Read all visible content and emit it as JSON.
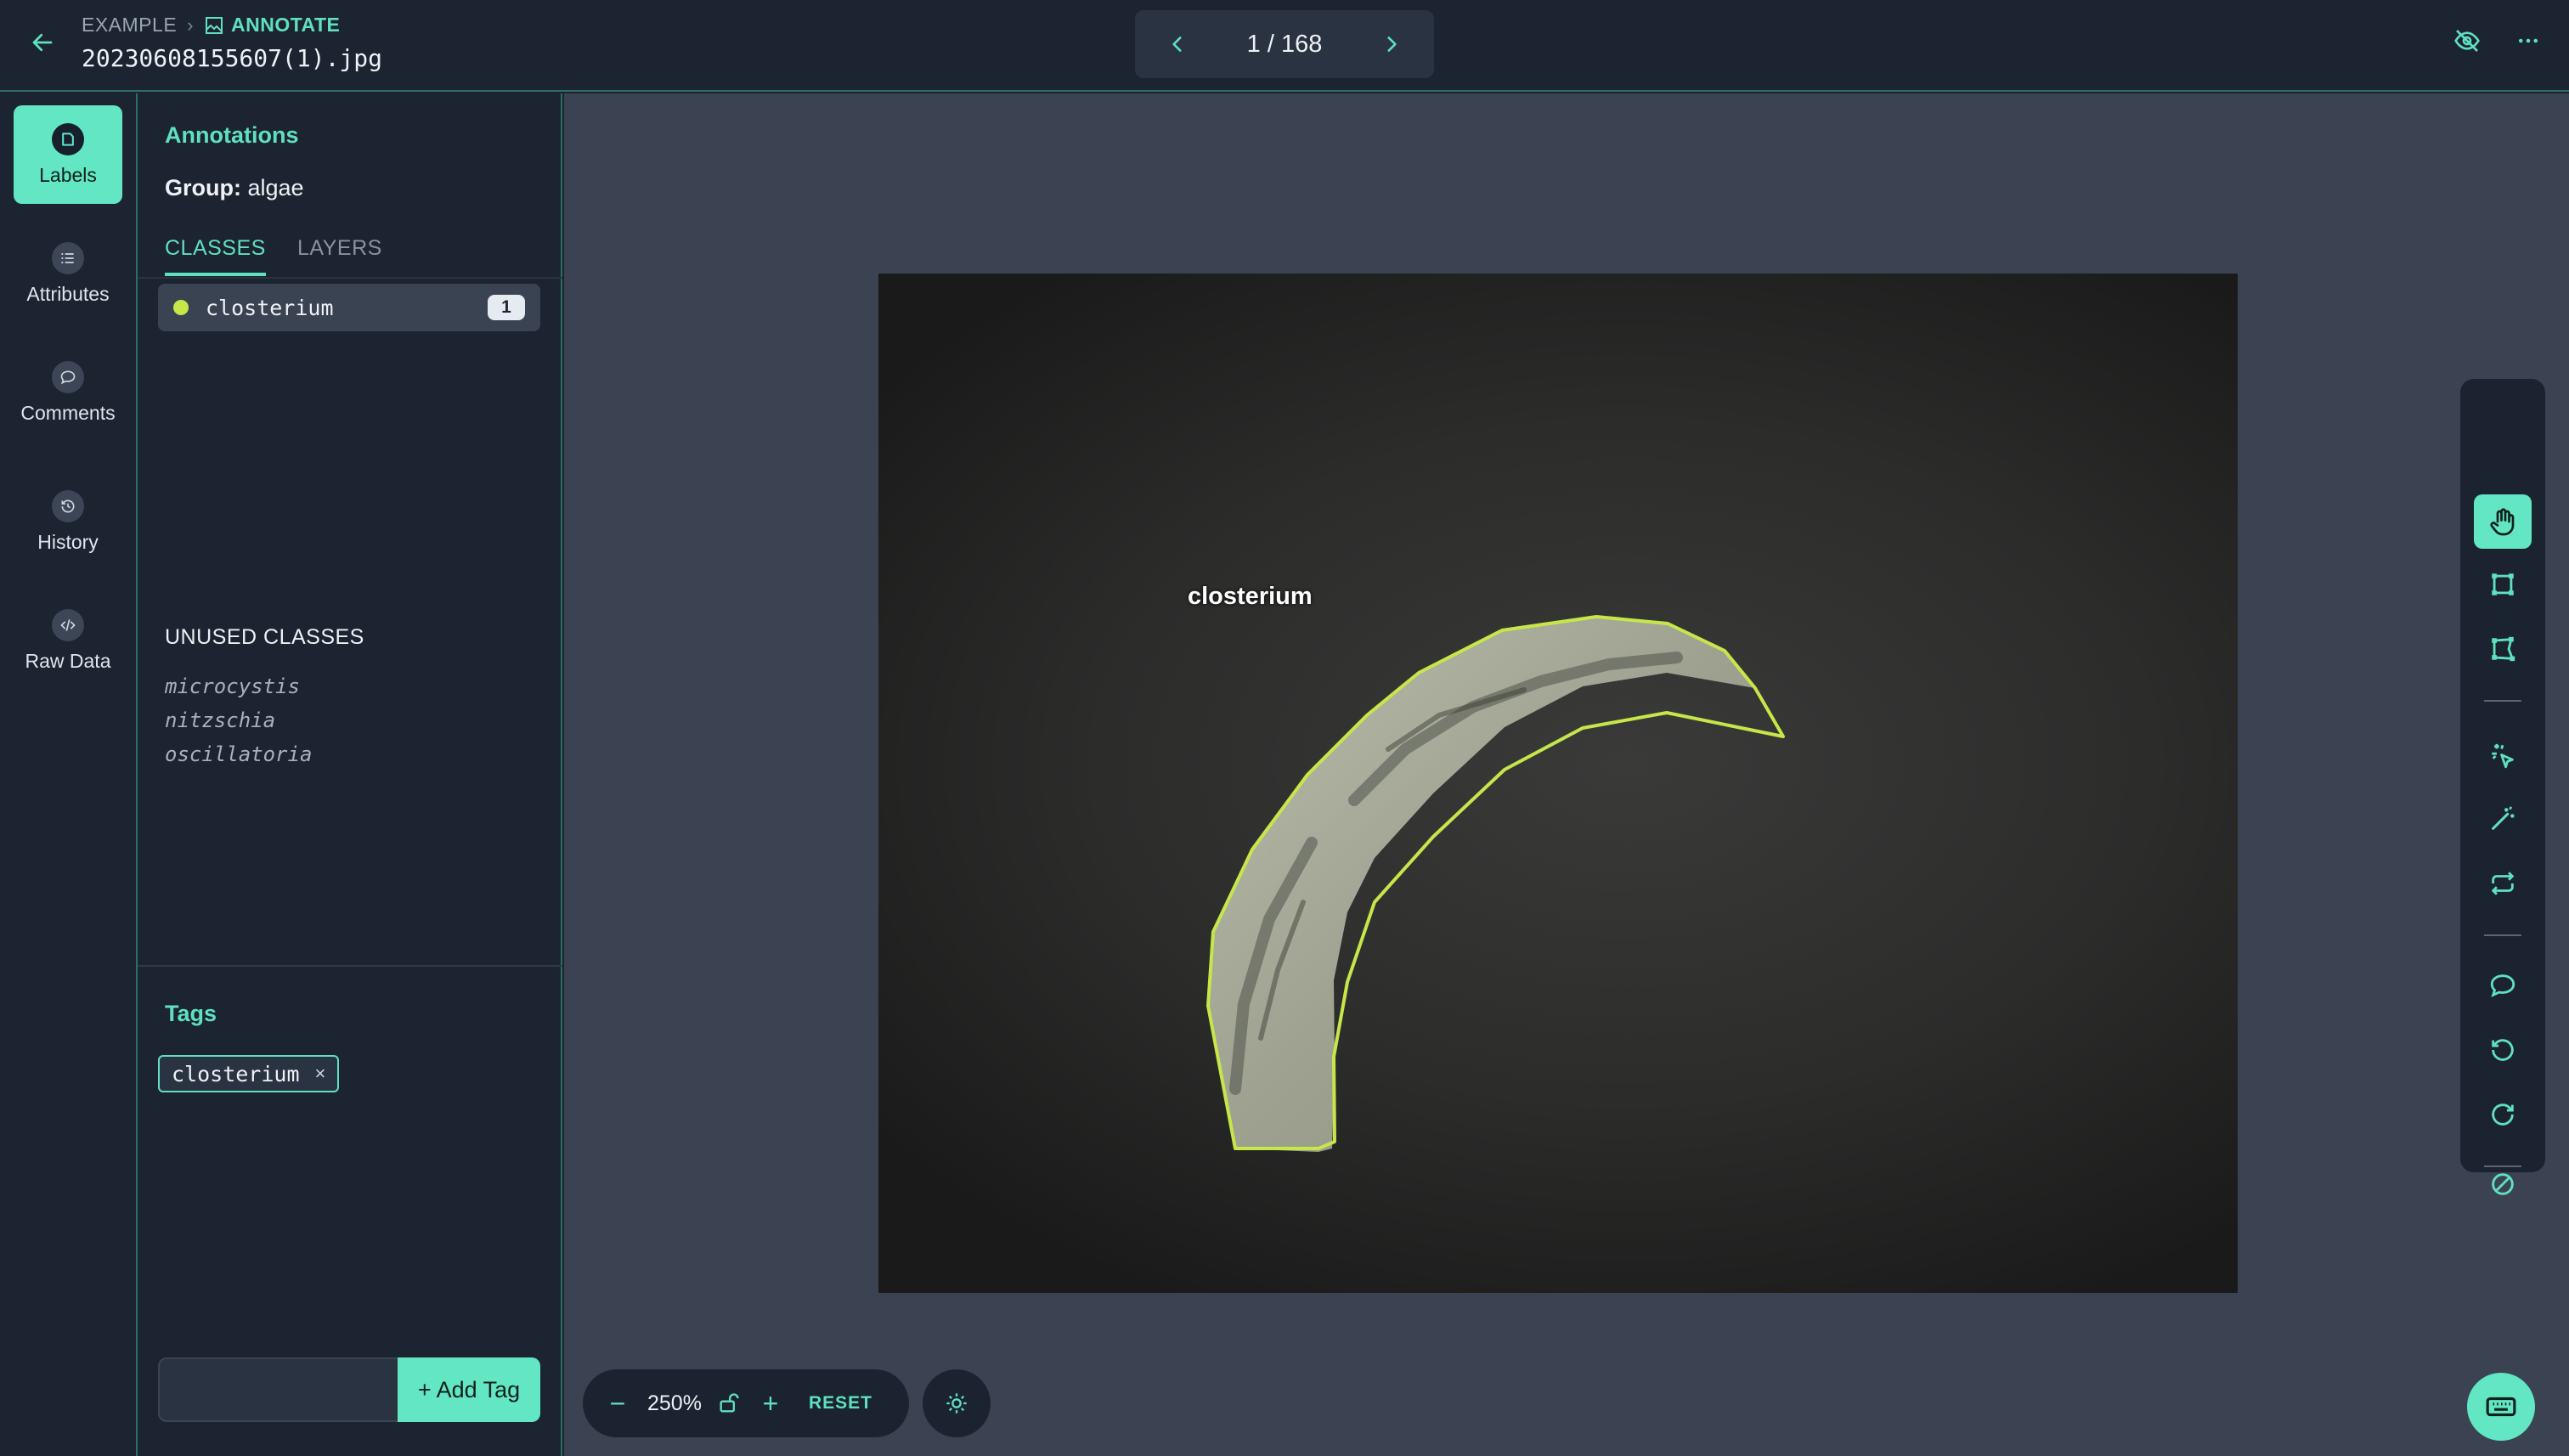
{
  "header": {
    "breadcrumb_root": "EXAMPLE",
    "breadcrumb_current": "ANNOTATE",
    "filename": "20230608155607(1).jpg",
    "pager": "1 / 168"
  },
  "rail": {
    "items": [
      {
        "label": "Labels",
        "icon": "label-icon",
        "active": true
      },
      {
        "label": "Attributes",
        "icon": "list-icon"
      },
      {
        "label": "Comments",
        "icon": "comment-icon"
      },
      {
        "label": "History",
        "icon": "history-icon"
      },
      {
        "label": "Raw Data",
        "icon": "code-icon"
      }
    ]
  },
  "panel": {
    "title": "Annotations",
    "group_label": "Group:",
    "group_value": "algae",
    "tabs": [
      "CLASSES",
      "LAYERS"
    ],
    "classes": [
      {
        "name": "closterium",
        "count": "1",
        "color": "#c6e64a"
      }
    ],
    "unused_title": "UNUSED CLASSES",
    "unused": [
      "microcystis",
      "nitzschia",
      "oscillatoria"
    ],
    "tags_title": "Tags",
    "tags": [
      "closterium"
    ],
    "tag_remove": "×",
    "tag_input_placeholder": "",
    "add_tag_label": "+ Add Tag"
  },
  "canvas": {
    "annotation_label": "closterium",
    "zoom": "250%",
    "zoom_out": "−",
    "zoom_in": "+",
    "reset": "RESET"
  },
  "colors": {
    "accent": "#62e6c4",
    "polygon": "#c6e64a"
  }
}
